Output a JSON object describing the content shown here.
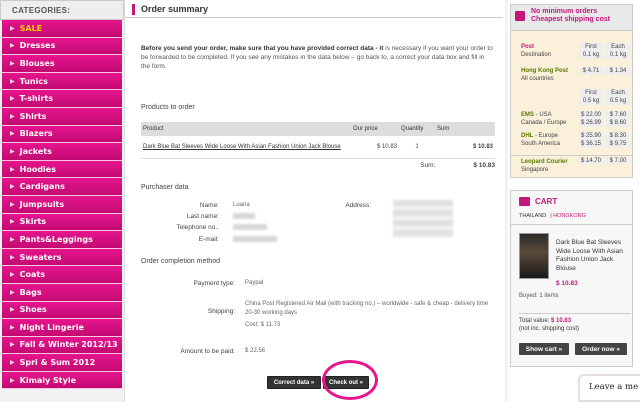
{
  "sidebar": {
    "header": "CATEGORIES:",
    "items": [
      "SALE",
      "Dresses",
      "Blouses",
      "Tunics",
      "T-shirts",
      "Shirts",
      "Blazers",
      "Jackets",
      "Hoodies",
      "Cardigans",
      "Jumpsuits",
      "Skirts",
      "Pants&Leggings",
      "Sweaters",
      "Coats",
      "Bags",
      "Shoes",
      "Night Lingerie",
      "Fall & Winter 2012/13",
      "Spri & Sum 2012",
      "Kimaly Style"
    ]
  },
  "main": {
    "title": "Order summary",
    "intro_bold": "Before you send your order, make sure that you have provided correct data - it",
    "intro_rest": " is necessary if you want your order to be forwarded to be completed. If you see any mistakes in the data below – go back to, a correct your data box and fill in the form.",
    "products_header": "Products to order",
    "table_headers": {
      "product": "Product",
      "price": "Our price",
      "qty": "Quantity",
      "sum": "Sum"
    },
    "product": {
      "name": "Dark Blue Bat Sleeves Wide Loose With Asian Fashion Union Jack Blouse",
      "price": "$ 10.83",
      "qty": "1",
      "sum": "$ 10.83"
    },
    "sum_label": "Sum:",
    "sum_value": "$ 10.83",
    "purchaser_header": "Purchaser data",
    "purchaser": {
      "name_label": "Name:",
      "name_value": "Luana",
      "lastname_label": "Last name:",
      "phone_label": "Telephone no.:",
      "email_label": "E-mail:",
      "address_label": "Address:"
    },
    "completion_header": "Order completion method",
    "payment_label": "Payment type:",
    "payment_value": "Paypal",
    "shipping_label": "Shipping:",
    "shipping_value": "China Post Registered Air Mail (with tracking no.) – worldwide - safe & cheap - delivery time 20-30 working days",
    "shipping_cost": "Cost: $ 11.73",
    "amount_label": "Amount to be paid:",
    "amount_value": "$ 22.56",
    "correct_button": "Correct data  »",
    "checkout_button": "Check out  »",
    "accent_color": "#e6158e"
  },
  "shipping_box": {
    "title_line1": "No minimum orders",
    "title_line2": "Cheapest shipping cost",
    "post_label": "Post",
    "destination_label": "Destination",
    "col_first": "First",
    "col_first_w": "0.1 kg",
    "col_each": "Each",
    "col_each_w": "0.1 kg",
    "hk_label": "Hong Kong Post",
    "hk_dest": "All countries",
    "hk_first": "$ 4.71",
    "hk_each": "$ 1.34",
    "first2": "First",
    "first2_w": "0.5 kg",
    "each2": "Each",
    "each2_w": "0.5 kg",
    "ems_label": "EMS",
    "ems_dest1": " - USA",
    "ems_dest2": "Canada / Europe",
    "ems_first1": "$ 22.00",
    "ems_each1": "$ 7.60",
    "ems_first2": "$ 26.99",
    "ems_each2": "$ 8.60",
    "dhl_label": "DHL",
    "dhl_dest1": " - Europe",
    "dhl_dest2": "South America",
    "dhl_first1": "$ 25.90",
    "dhl_each1": "$ 8.30",
    "dhl_first2": "$ 36.15",
    "dhl_each2": "$ 9.75",
    "leopard_label": "Leopard Courier",
    "leopard_dest": "Singapore",
    "leopard_first": "$ 14.70",
    "leopard_each": "$ 7.00"
  },
  "cart": {
    "title": "CART",
    "tab1": "THAILAND",
    "tab2": "HONGKONG",
    "item_name": "Dark Blue Bat Sleeves Wide Loose With Asian Fashion Union Jack Blouse",
    "item_price": "$ 10.83",
    "bought": "Buyed: 1 items",
    "total_label": "Total value:",
    "total_value": "$ 10.83",
    "total_note": "(not inc. shipping cost)",
    "show_button": "Show cart  »",
    "order_button": "Order now  »"
  },
  "leave_message": "Leave a me"
}
